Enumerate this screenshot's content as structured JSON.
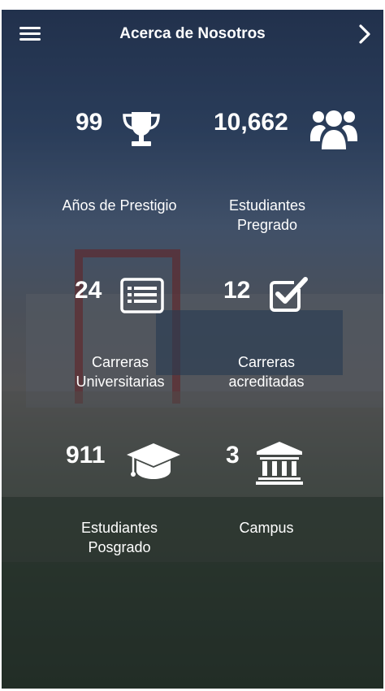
{
  "header": {
    "title": "Acerca de Nosotros"
  },
  "stats": [
    {
      "value": "99",
      "line1": "Años de Prestigio",
      "line2": "",
      "icon": "trophy-icon"
    },
    {
      "value": "10,662",
      "line1": "Estudiantes",
      "line2": "Pregrado",
      "icon": "users-icon"
    },
    {
      "value": "24",
      "line1": "Carreras",
      "line2": "Universitarias",
      "icon": "list-icon"
    },
    {
      "value": "12",
      "line1": "Carreras",
      "line2": "acreditadas",
      "icon": "checkbox-icon"
    },
    {
      "value": "911",
      "line1": "Estudiantes",
      "line2": "Posgrado",
      "icon": "graduation-cap-icon"
    },
    {
      "value": "3",
      "line1": "Campus",
      "line2": "",
      "icon": "institution-icon"
    }
  ]
}
